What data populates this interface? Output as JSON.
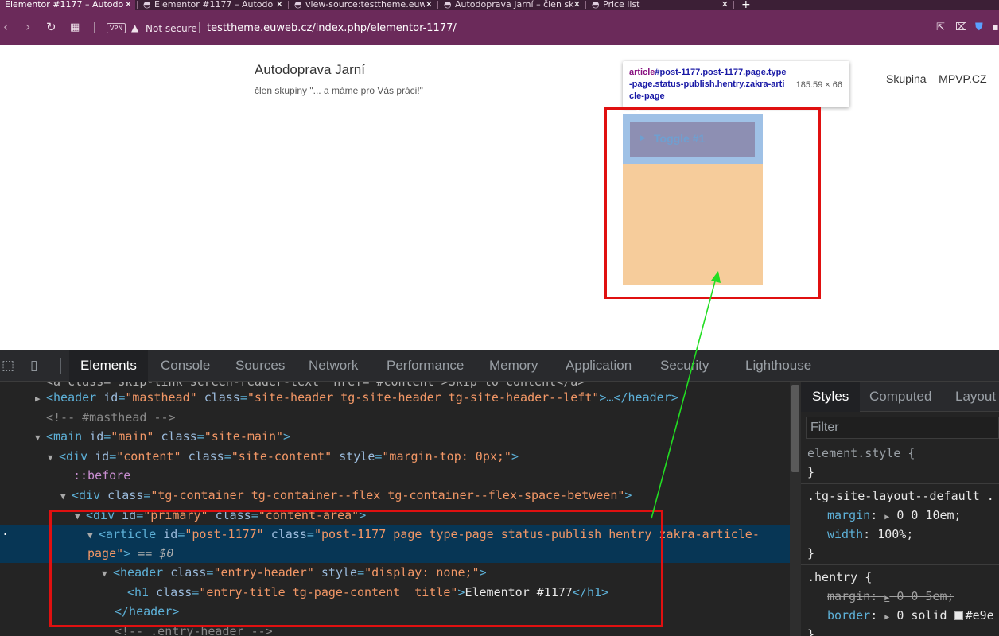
{
  "browser": {
    "tabs": [
      {
        "label": "Elementor #1177 – Autodo",
        "active": true
      },
      {
        "label": "Elementor #1177 – Autodo",
        "active": false
      },
      {
        "label": "view-source:testtheme.euw",
        "active": false
      },
      {
        "label": "Autodoprava Jarní – člen sk",
        "active": false
      },
      {
        "label": "Price list",
        "active": false
      }
    ],
    "close_glyph": "✕",
    "new_tab_glyph": "+",
    "vpn_label": "VPN",
    "not_secure_label": "Not secure",
    "url": "testtheme.euweb.cz/index.php/elementor-1177/"
  },
  "page": {
    "site_title": "Autodoprava Jarní",
    "site_tagline": "člen skupiny \"... a máme pro Vás práci!\"",
    "menu_link": "Skupina – MPVP.CZ",
    "toggle_label": "Toggle #1"
  },
  "inspect_tooltip": {
    "tag": "article",
    "selector": "#post-1177.post-1177.page.type-page.status-publish.hentry.zakra-article-page",
    "size": "185.59 × 66"
  },
  "devtools": {
    "tabs": [
      "Elements",
      "Console",
      "Sources",
      "Network",
      "Performance",
      "Memory",
      "Application",
      "Security",
      "Lighthouse"
    ],
    "active_tab": "Elements",
    "dom": {
      "line0": "<a class=\"skip-link screen-reader-text\" href=\"#content\">Skip to content</a>",
      "header_open": "<header",
      "header_attr_id": "id",
      "header_val_id": "\"masthead\"",
      "header_attr_class": "class",
      "header_val_class": "\"site-header tg-site-header tg-site-header--left\"",
      "header_close": ">…</header>",
      "comment_masthead": "<!-- #masthead -->",
      "main_open": "<main",
      "main_val_id": "\"main\"",
      "main_val_class": "\"site-main\"",
      "div_content_val_id": "\"content\"",
      "div_content_val_class": "\"site-content\"",
      "div_content_attr_style": "style",
      "div_content_val_style": "\"margin-top: 0px;\"",
      "before_pseudo": "::before",
      "container_val_class": "\"tg-container tg-container--flex tg-container--flex-space-between\"",
      "primary_val_id": "\"primary\"",
      "primary_val_class": "\"content-area\"",
      "article_val_id": "\"post-1177\"",
      "article_val_class_1": "\"post-1177 page type-page status-publish hentry zakra-article-",
      "article_val_class_2": "page\"",
      "article_eq": " == $0",
      "entry_header_val_class": "\"entry-header\"",
      "entry_header_val_style": "\"display: none;\"",
      "h1_val_class": "\"entry-title tg-page-content__title\"",
      "h1_text": "Elementor #1177",
      "header_end": "</header>",
      "comment_entry_header": "<!-- .entry-header -->"
    },
    "styles": {
      "tabs": [
        "Styles",
        "Computed",
        "Layout"
      ],
      "filter_placeholder": "Filter",
      "element_style": "element.style {",
      "close_brace": "}",
      "rule1_selector": ".tg-site-layout--default .",
      "rule1_margin_name": "margin",
      "rule1_margin_val": "0 0 10em;",
      "rule1_width_name": "width",
      "rule1_width_val": "100%;",
      "rule2_selector": ".hentry {",
      "rule2_margin_name": "margin",
      "rule2_margin_val": "0 0 5em;",
      "rule2_border_name": "border",
      "rule2_border_val": "0 solid",
      "rule2_border_color": "#e9e"
    }
  },
  "colors": {
    "chrome_bg": "#6b2a5a",
    "highlight_red": "#e01010",
    "arrow_green": "#22dd22",
    "margin_overlay": "#f6cc9b",
    "content_overlay": "#9fc1e6"
  }
}
